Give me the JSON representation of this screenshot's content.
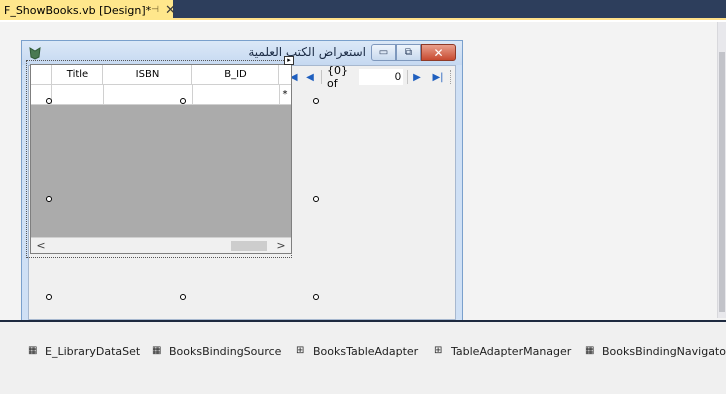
{
  "document_tab": {
    "title": "F_ShowBooks.vb [Design]*",
    "pin_glyph": "⊣",
    "close_glyph": "✕"
  },
  "form": {
    "title": "استعراض الكتب العلمية",
    "min_glyph": "▭",
    "max_glyph": "⧉",
    "close_glyph": "✕",
    "icon": "app-icon"
  },
  "navigator": {
    "save_icon": "save-icon",
    "save_glyph": "💾",
    "delete_glyph": "✕",
    "add_glyph": "✚",
    "first_glyph": "|◀",
    "prev_glyph": "◀",
    "count_text": "{0} of",
    "position_value": "0",
    "next_glyph": "▶",
    "last_glyph": "▶|"
  },
  "grid": {
    "columns": [
      "Title",
      "ISBN",
      "B_ID"
    ],
    "new_row_marker": "*",
    "scroll_left": "<",
    "scroll_right": ">",
    "smart_tag": "▸"
  },
  "tray": {
    "items": [
      {
        "label": "E_LibraryDataSet",
        "icon": "dataset-icon",
        "glyph": "▦"
      },
      {
        "label": "BooksBindingSource",
        "icon": "binding-source-icon",
        "glyph": "▦"
      },
      {
        "label": "BooksTableAdapter",
        "icon": "table-adapter-icon",
        "glyph": "⊞"
      },
      {
        "label": "TableAdapterManager",
        "icon": "table-adapter-manager-icon",
        "glyph": "⊞"
      },
      {
        "label": "BooksBindingNavigator",
        "icon": "binding-navigator-icon",
        "glyph": "▦"
      }
    ]
  },
  "colors": {
    "tab_active": "#ffe78c",
    "tabstrip": "#2d3e5c",
    "form_caption": "#c6d9f1",
    "grid_background": "#ababab",
    "close_button": "#c74a30"
  }
}
